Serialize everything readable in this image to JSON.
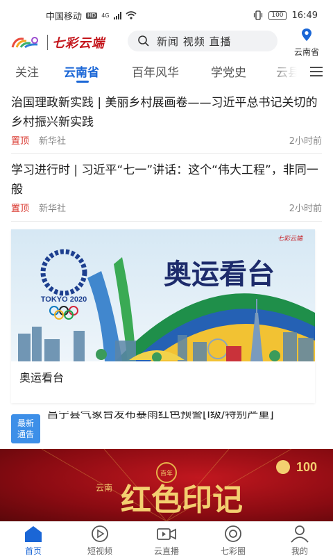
{
  "status_bar": {
    "carrier": "中国移动",
    "hd": "HD",
    "network": "4G",
    "battery": "100",
    "time": "16:49"
  },
  "header": {
    "logo_text": "七彩云端",
    "search_placeholder": "新闻 视频 直播",
    "location_label": "云南省"
  },
  "tabs": [
    {
      "label": "关注",
      "active": false
    },
    {
      "label": "云南省",
      "active": true
    },
    {
      "label": "百年风华",
      "active": false
    },
    {
      "label": "学党史",
      "active": false
    },
    {
      "label": "云县",
      "active": false
    }
  ],
  "news": [
    {
      "title": "治国理政新实践 | 美丽乡村展画卷——习近平总书记关切的乡村振兴新实践",
      "tag": "置顶",
      "source": "新华社",
      "time": "2小时前"
    },
    {
      "title": "学习进行时 | 习近平“七一”讲话：这个“伟大工程”，非同一般",
      "tag": "置顶",
      "source": "新华社",
      "time": "2小时前"
    }
  ],
  "feature": {
    "image_logo_text": "七彩云端",
    "image_title": "奥运看台",
    "olympic_text": "TOKYO 2020",
    "label": "奥运看台"
  },
  "notice": {
    "badge_line1": "最新",
    "badge_line2": "通告",
    "text": "昌宁县气象台发布暴雨红色预警[Ⅰ级/特别严重]"
  },
  "banner": {
    "emblem_text": "百年",
    "side_text": "云南",
    "title": "红色印记",
    "centenary": "100"
  },
  "bottom_nav": [
    {
      "label": "首页",
      "icon": "home-icon",
      "active": true
    },
    {
      "label": "短视频",
      "icon": "play-icon",
      "active": false
    },
    {
      "label": "云直播",
      "icon": "video-camera-icon",
      "active": false
    },
    {
      "label": "七彩圈",
      "icon": "circle-icon",
      "active": false
    },
    {
      "label": "我的",
      "icon": "user-icon",
      "active": false
    }
  ],
  "colors": {
    "accent": "#1a66d6",
    "pinned": "#d9342b",
    "banner_red": "#c1171f"
  }
}
